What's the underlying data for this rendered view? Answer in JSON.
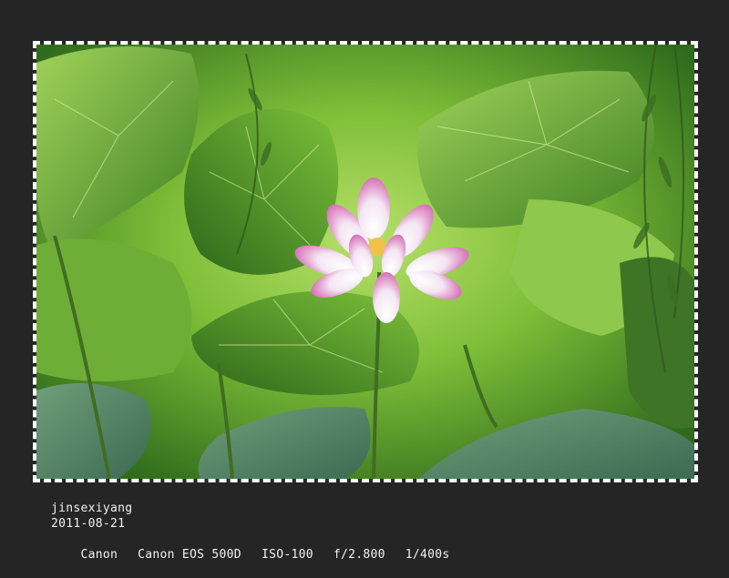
{
  "photo": {
    "subject": "pink-lotus-flower",
    "colors": {
      "background": "#252525",
      "leaf_dark": "#2f6b1c",
      "leaf_mid": "#5a9a2a",
      "leaf_light": "#9fd25a",
      "petal": "#f4e6f3",
      "petal_tip": "#d66fb7",
      "border": "#ffffff"
    }
  },
  "exif": {
    "author": "jinsexiyang",
    "date": "2011-08-21",
    "make": "Canon",
    "model": "Canon EOS 500D",
    "iso": "ISO-100",
    "aperture": "f/2.800",
    "shutter": "1/400s"
  }
}
